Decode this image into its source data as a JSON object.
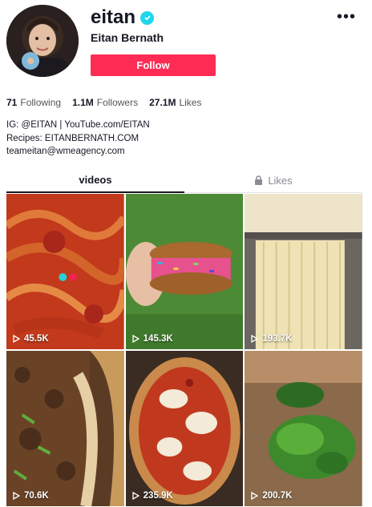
{
  "profile": {
    "username": "eitan",
    "display_name": "Eitan Bernath",
    "follow_label": "Follow",
    "more_label": "•••"
  },
  "stats": {
    "following_count": "71",
    "following_label": "Following",
    "followers_count": "1.1M",
    "followers_label": "Followers",
    "likes_count": "27.1M",
    "likes_label": "Likes"
  },
  "bio": {
    "line1": "IG: @EITAN | YouTube.com/EITAN",
    "line2": "Recipes: EITANBERNATH.COM",
    "line3": "teameitan@wmeagency.com"
  },
  "tabs": [
    {
      "label": "videos",
      "active": true
    },
    {
      "label": "Likes",
      "active": false,
      "icon": "lock-icon"
    }
  ],
  "videos": [
    {
      "views": "45.5K",
      "subject": "spaghetti"
    },
    {
      "views": "145.3K",
      "subject": "sprinkle cookie sandwich"
    },
    {
      "views": "193.7K",
      "subject": "fresh pasta"
    },
    {
      "views": "70.6K",
      "subject": "ground meat flatbread"
    },
    {
      "views": "235.9K",
      "subject": "pizza"
    },
    {
      "views": "200.7K",
      "subject": "chopped herbs"
    }
  ],
  "colors": {
    "brand_red": "#fe2c55",
    "verified": "#20d5ec",
    "text": "#161823",
    "muted": "#8a8b91"
  }
}
